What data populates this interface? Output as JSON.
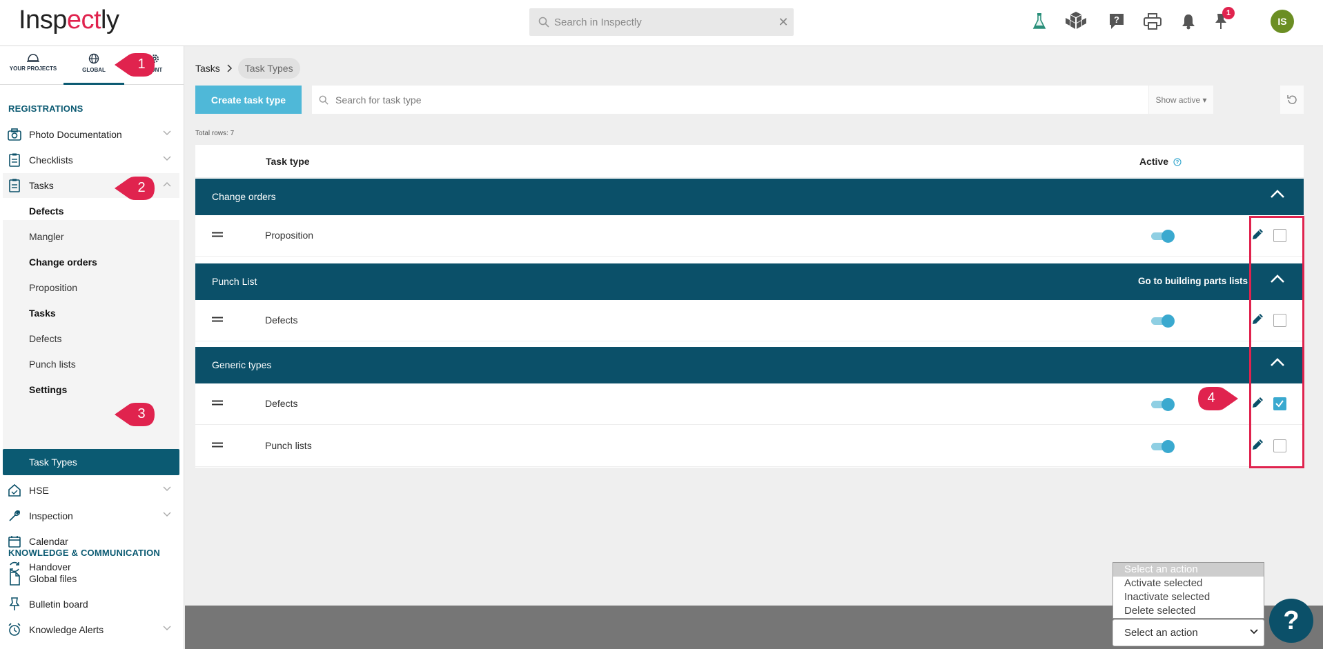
{
  "app": {
    "logo_text_a": "Insp",
    "logo_text_b": "ect",
    "logo_text_c": "ly",
    "search_placeholder": "Search in Inspectly",
    "notification_count": "1",
    "avatar_initials": "IS"
  },
  "sidebar": {
    "tabs": [
      {
        "label": "YOUR PROJECTS"
      },
      {
        "label": "GLOBAL"
      },
      {
        "label": "OUNT"
      }
    ],
    "sections": {
      "registrations": "REGISTRATIONS",
      "knowledge": "KNOWLEDGE & COMMUNICATION"
    },
    "items": {
      "photo": "Photo Documentation",
      "checklists": "Checklists",
      "tasks": "Tasks",
      "hse": "HSE",
      "inspection": "Inspection",
      "calendar": "Calendar",
      "handover": "Handover",
      "global_files": "Global files",
      "bulletin": "Bulletin board",
      "alerts": "Knowledge Alerts"
    },
    "task_sub": [
      {
        "label": "Defects",
        "bold": true
      },
      {
        "label": "Mangler",
        "bold": false
      },
      {
        "label": "Change orders",
        "bold": true
      },
      {
        "label": "Proposition",
        "bold": false
      },
      {
        "label": "Tasks",
        "bold": true
      },
      {
        "label": "Defects",
        "bold": false
      },
      {
        "label": "Punch lists",
        "bold": false
      },
      {
        "label": "Settings",
        "bold": true
      },
      {
        "label": "Task Types",
        "selected": true
      }
    ]
  },
  "breadcrumb": {
    "root": "Tasks",
    "current": "Task Types"
  },
  "toolbar": {
    "create_label": "Create task type",
    "search_placeholder": "Search for task type",
    "show_active_label": "Show active"
  },
  "table": {
    "total_rows": "Total rows: 7",
    "col_task_type": "Task type",
    "col_active": "Active",
    "groups": [
      {
        "name": "Change orders",
        "link": "",
        "rows": [
          {
            "name": "Proposition",
            "active": true,
            "checked": false
          }
        ]
      },
      {
        "name": "Punch List",
        "link": "Go to building parts lists",
        "rows": [
          {
            "name": "Defects",
            "active": true,
            "checked": false
          }
        ]
      },
      {
        "name": "Generic types",
        "link": "",
        "rows": [
          {
            "name": "Defects",
            "active": true,
            "checked": true
          },
          {
            "name": "Punch lists",
            "active": true,
            "checked": false
          }
        ]
      }
    ]
  },
  "actions": {
    "options": [
      "Select an action",
      "Activate selected",
      "Inactivate selected",
      "Delete selected"
    ],
    "selected": "Select an action"
  },
  "help_label": "?",
  "callouts": [
    "1",
    "2",
    "3",
    "4"
  ],
  "colors": {
    "primary": "#0b5069",
    "accent": "#4fb8d8",
    "callout": "#e0234e"
  }
}
